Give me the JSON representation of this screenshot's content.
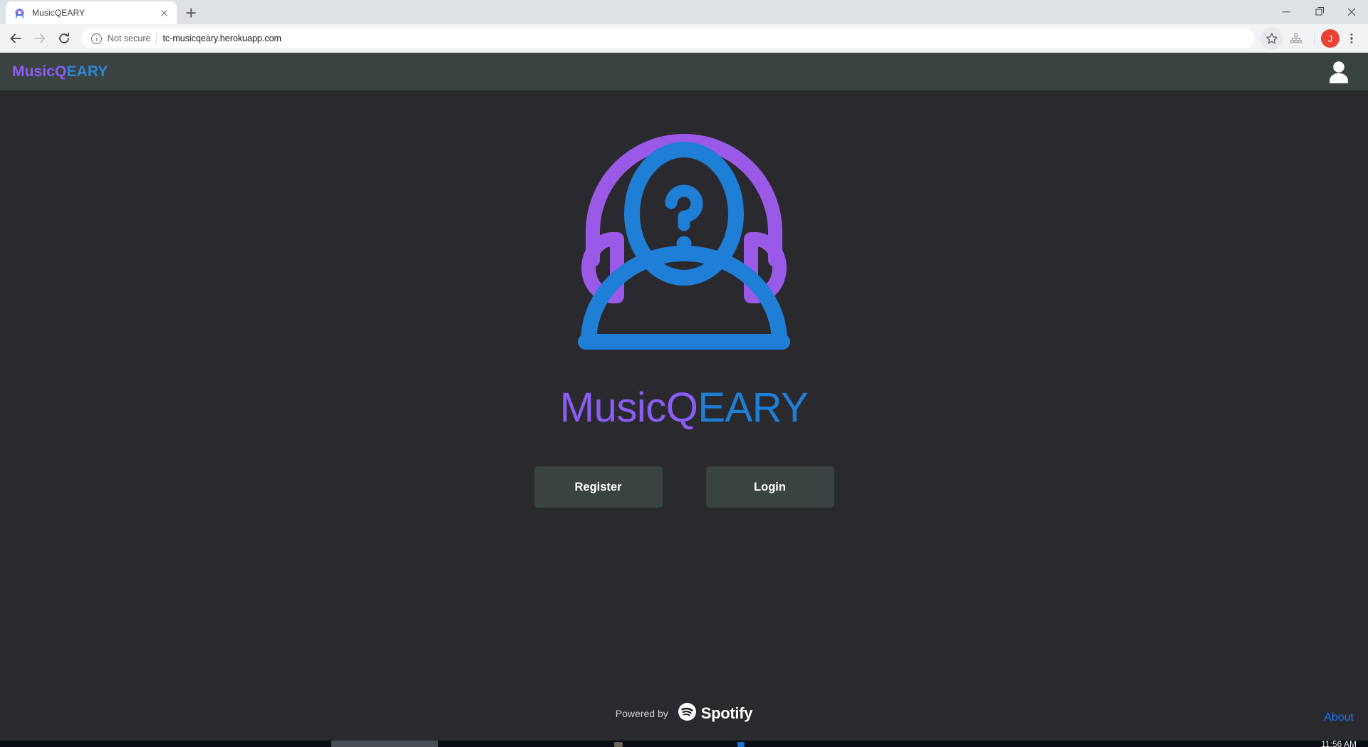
{
  "browser": {
    "tab": {
      "title": "MusicQEARY",
      "favicon_icon": "musicqeary-logo-icon",
      "close_icon": "close-icon"
    },
    "new_tab_icon": "plus-icon",
    "window_controls": {
      "minimize_icon": "minimize-icon",
      "restore_icon": "restore-icon",
      "close_icon": "close-icon"
    },
    "toolbar": {
      "back_icon": "back-arrow-icon",
      "forward_icon": "forward-arrow-icon",
      "reload_icon": "reload-icon",
      "security_icon": "info-circle-icon",
      "security_label": "Not secure",
      "url": "tc-musicqeary.herokuapp.com",
      "bookmark_icon": "star-icon",
      "extension_icon": "sitemap-icon",
      "profile_initial": "J",
      "menu_icon": "kebab-menu-icon"
    }
  },
  "app": {
    "navbar": {
      "brand_part1": "MusicQ",
      "brand_part2": "EARY",
      "account_icon": "user-avatar-icon"
    },
    "hero": {
      "logo_icon": "headphones-person-question-logo",
      "wordmark_part1": "MusicQ",
      "wordmark_part2": "EARY"
    },
    "actions": [
      {
        "label": "Register",
        "name": "register-button"
      },
      {
        "label": "Login",
        "name": "login-button"
      }
    ],
    "footer": {
      "powered_by": "Powered by",
      "spotify_icon": "spotify-logo-icon",
      "spotify_name": "Spotify",
      "about_label": "About"
    }
  },
  "desktop": {
    "taskbar_clock": "11:56 AM"
  },
  "colors": {
    "page_background": "#2a2a2e",
    "navbar_background": "#3a4341",
    "brand_purple": "#8b5cf6",
    "brand_blue": "#1f7fd6",
    "button_background": "#3a4341",
    "link_blue": "#1a6ff0"
  }
}
